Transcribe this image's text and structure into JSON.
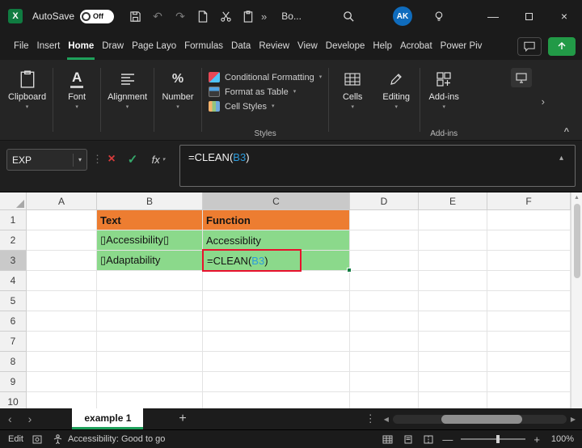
{
  "colors": {
    "accent-green": "#1EA15B",
    "excel-green": "#107C41",
    "share-green": "#229A47",
    "cell-orange": "#ED7D31",
    "cell-green": "#8BD98B",
    "annotation-red": "#E8112D",
    "ref-blue": "#2D9CDB",
    "avatar-blue": "#0F6CBD",
    "cancel-red": "#D83B3B"
  },
  "titlebar": {
    "autosave": "AutoSave",
    "autosave_state": "Off",
    "doc_title": "Bo...",
    "avatar": "AK"
  },
  "ribbon_tabs": [
    "File",
    "Insert",
    "Home",
    "Draw",
    "Page Layo",
    "Formulas",
    "Data",
    "Review",
    "View",
    "Develope",
    "Help",
    "Acrobat",
    "Power Piv"
  ],
  "active_tab": "Home",
  "ribbon": {
    "groups": {
      "clipboard": "Clipboard",
      "font": "Font",
      "alignment": "Alignment",
      "number": "Number",
      "cells": "Cells",
      "editing": "Editing",
      "addins_button": "Add-ins",
      "styles_label": "Styles",
      "addins_label": "Add-ins"
    },
    "styles_items": [
      "Conditional Formatting",
      "Format as Table",
      "Cell Styles"
    ]
  },
  "formulabar": {
    "name_box": "EXP",
    "fx_label": "fx",
    "formula_parts": [
      {
        "t": "=CLEAN(",
        "is_ref": false
      },
      {
        "t": "B3",
        "is_ref": true
      },
      {
        "t": ")",
        "is_ref": false
      }
    ]
  },
  "grid": {
    "columns": [
      "A",
      "B",
      "C",
      "D",
      "E",
      "F"
    ],
    "rows": [
      1,
      2,
      3,
      4,
      5,
      6,
      7,
      8,
      9,
      10
    ],
    "selected_column": "C",
    "selected_row": 3,
    "cells": [
      {
        "ref": "B1",
        "text": "Text",
        "fill": "cell-orange",
        "bold": true
      },
      {
        "ref": "C1",
        "text": "Function",
        "fill": "cell-orange",
        "bold": true
      },
      {
        "ref": "B2",
        "text": "▯Accessibility▯",
        "fill": "cell-green"
      },
      {
        "ref": "C2",
        "text": "Accessiblity",
        "fill": "cell-green"
      },
      {
        "ref": "B3",
        "text": "▯Adaptability",
        "fill": "cell-green"
      },
      {
        "ref": "C3",
        "fill": "cell-green",
        "use_formula_parts": true,
        "annotation": "red-box"
      }
    ]
  },
  "sheetbar": {
    "active_tab": "example 1"
  },
  "statusbar": {
    "mode": "Edit",
    "accessibility": "Accessibility: Good to go",
    "zoom": "100%"
  }
}
